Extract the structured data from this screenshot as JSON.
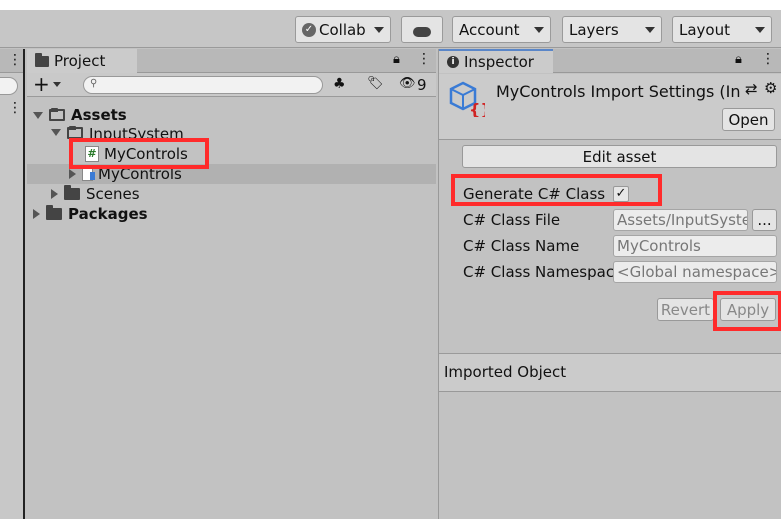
{
  "toolbar": {
    "collab_label": "Collab",
    "account_label": "Account",
    "layers_label": "Layers",
    "layout_label": "Layout"
  },
  "project": {
    "tab_label": "Project",
    "filter_count": "9",
    "search_placeholder": "",
    "tree": {
      "assets": "Assets",
      "input_system": "InputSystem",
      "my_controls_script": "MyControls",
      "my_controls_asset": "MyControls",
      "scenes": "Scenes",
      "packages": "Packages"
    }
  },
  "inspector": {
    "tab_label": "Inspector",
    "title": "MyControls Import Settings (In",
    "open_label": "Open",
    "edit_asset_label": "Edit asset",
    "generate_label": "Generate C# Class",
    "generate_checked": "✓",
    "class_file_label": "C# Class File",
    "class_file_value": "Assets/InputSyste",
    "browse_label": "...",
    "class_name_label": "C# Class Name",
    "class_name_value": "MyControls",
    "namespace_label": "C# Class Namespace",
    "namespace_value": "<Global namespace>",
    "revert_label": "Revert",
    "apply_label": "Apply",
    "imported_object_label": "Imported Object"
  },
  "colors": {
    "highlight": "#ff2b2b",
    "tab_accent": "#5a86c8"
  }
}
